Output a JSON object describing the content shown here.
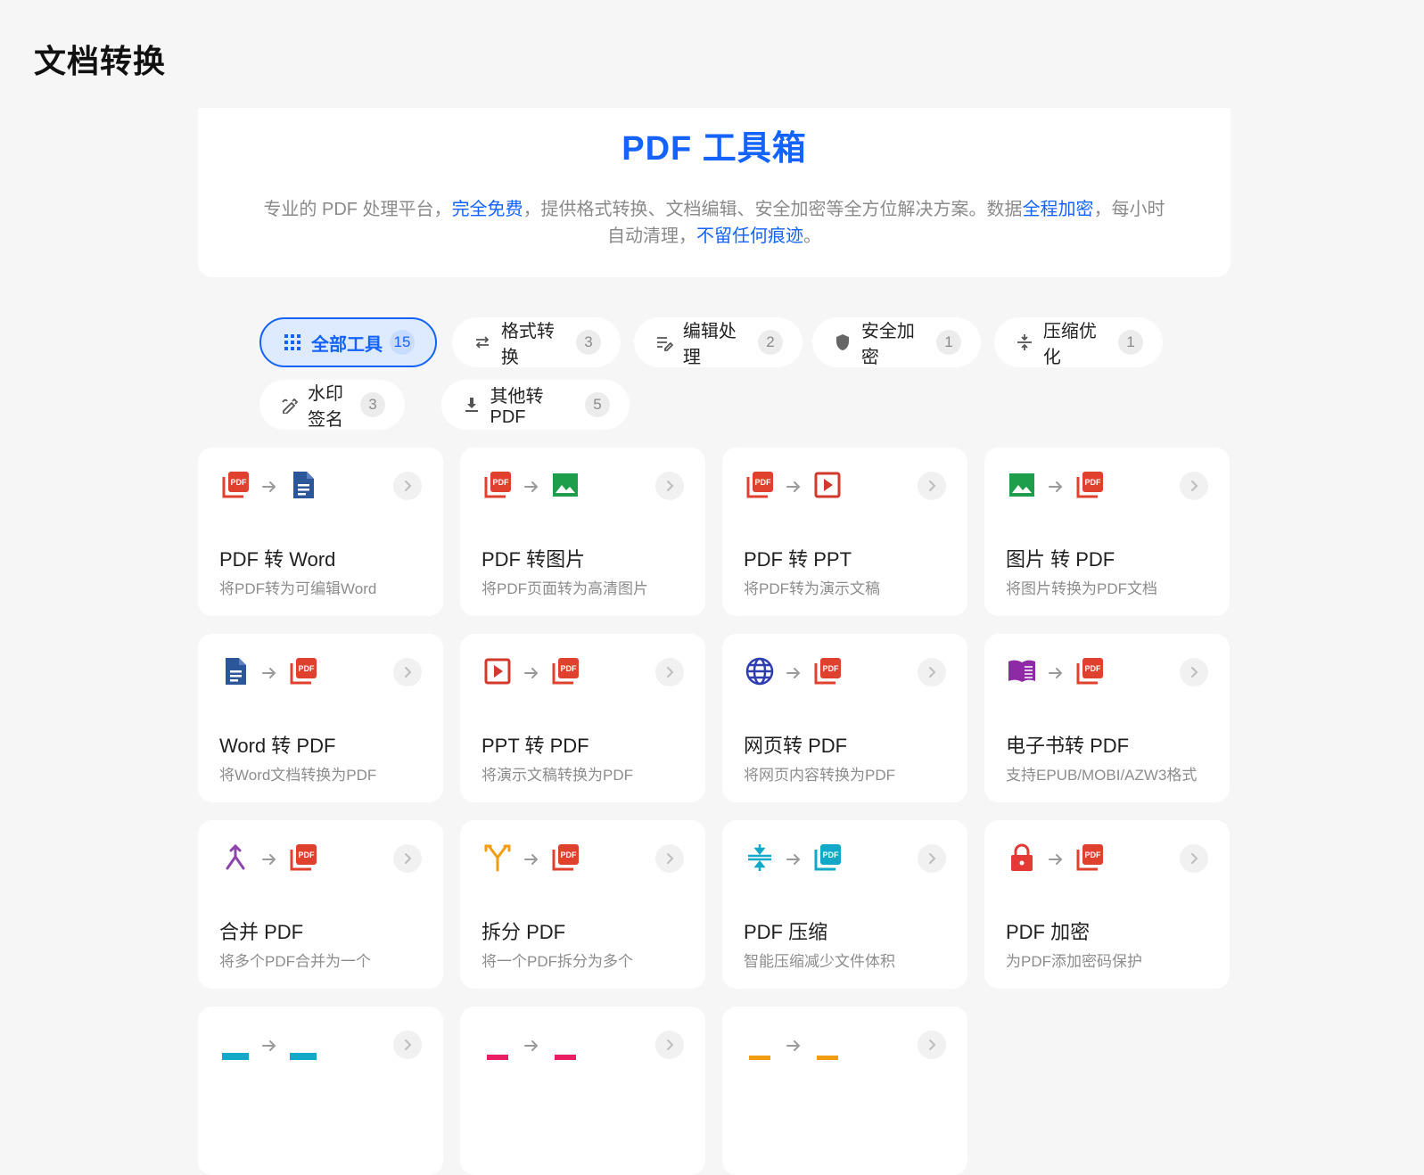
{
  "page": {
    "title": "文档转换"
  },
  "hero": {
    "title": "PDF 工具箱",
    "desc_1": "专业的 PDF 处理平台，",
    "desc_hl_1": "完全免费",
    "desc_2": "，提供格式转换、文档编辑、安全加密等全方位解决方案。数据",
    "desc_hl_2": "全程加密",
    "desc_3": "，每小时自动清理，",
    "desc_hl_3": "不留任何痕迹",
    "desc_4": "。"
  },
  "colors": {
    "accent": "#1463ff",
    "pdf_red": "#e0412e",
    "word_blue": "#2b579a",
    "image_green": "#1e9e4a",
    "merge_purple": "#8e44ad",
    "split_orange": "#f39c12",
    "compress_cyan": "#13a8c8",
    "lock_red": "#e53935"
  },
  "filters": [
    {
      "label": "全部工具",
      "count": "15",
      "icon": "grid-icon",
      "active": true
    },
    {
      "label": "格式转换",
      "count": "3",
      "icon": "swap-icon"
    },
    {
      "label": "编辑处理",
      "count": "2",
      "icon": "edit-icon"
    },
    {
      "label": "安全加密",
      "count": "1",
      "icon": "shield-icon"
    },
    {
      "label": "压缩优化",
      "count": "1",
      "icon": "compress-icon"
    },
    {
      "label": "水印签名",
      "count": "3",
      "icon": "signature-icon"
    },
    {
      "label": "其他转 PDF",
      "count": "5",
      "icon": "download-icon"
    }
  ],
  "tools": [
    {
      "title": "PDF 转 Word",
      "desc": "将PDF转为可编辑Word",
      "from": "pdf-icon",
      "to": "word-icon"
    },
    {
      "title": "PDF 转图片",
      "desc": "将PDF页面转为高清图片",
      "from": "pdf-icon",
      "to": "image-icon"
    },
    {
      "title": "PDF 转 PPT",
      "desc": "将PDF转为演示文稿",
      "from": "pdf-icon",
      "to": "ppt-icon"
    },
    {
      "title": "图片 转 PDF",
      "desc": "将图片转换为PDF文档",
      "from": "image-icon",
      "to": "pdf-icon"
    },
    {
      "title": "Word 转 PDF",
      "desc": "将Word文档转换为PDF",
      "from": "word-icon",
      "to": "pdf-icon"
    },
    {
      "title": "PPT 转 PDF",
      "desc": "将演示文稿转换为PDF",
      "from": "ppt-icon",
      "to": "pdf-icon"
    },
    {
      "title": "网页转 PDF",
      "desc": "将网页内容转换为PDF",
      "from": "globe-icon",
      "to": "pdf-icon"
    },
    {
      "title": "电子书转 PDF",
      "desc": "支持EPUB/MOBI/AZW3格式",
      "from": "book-icon",
      "to": "pdf-icon"
    },
    {
      "title": "合并 PDF",
      "desc": "将多个PDF合并为一个",
      "from": "merge-icon",
      "to": "pdf-icon"
    },
    {
      "title": "拆分 PDF",
      "desc": "将一个PDF拆分为多个",
      "from": "split-icon",
      "to": "pdf-icon"
    },
    {
      "title": "PDF 压缩",
      "desc": "智能压缩减少文件体积",
      "from": "compress-icon",
      "to": "pdf-cyan-icon"
    },
    {
      "title": "PDF 加密",
      "desc": "为PDF添加密码保护",
      "from": "lock-icon",
      "to": "pdf-icon"
    },
    {
      "title": "",
      "desc": "",
      "from": "cyan-partial-icon",
      "to": "cyan-partial-icon"
    },
    {
      "title": "",
      "desc": "",
      "from": "pink-partial-icon",
      "to": "pink-partial-icon"
    },
    {
      "title": "",
      "desc": "",
      "from": "orange-partial-icon",
      "to": "orange-partial-icon"
    }
  ]
}
